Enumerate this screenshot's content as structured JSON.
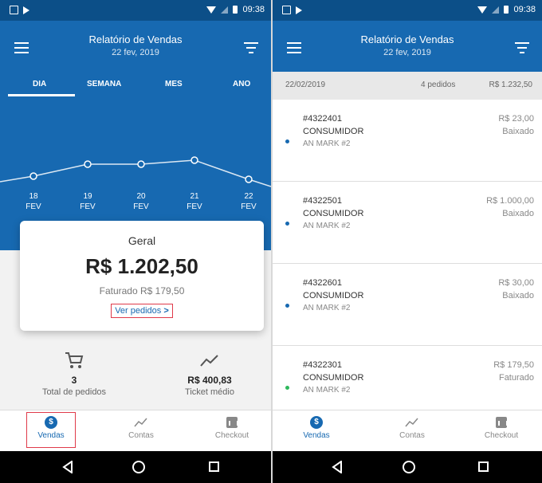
{
  "status": {
    "time": "09:38"
  },
  "colors": {
    "primary": "#1769b1",
    "dark": "#0c4f88",
    "highlight": "#e03a4a",
    "dot_blue": "#1769b1",
    "dot_green": "#2eb85c"
  },
  "left": {
    "header": {
      "title": "Relatório de Vendas",
      "subtitle": "22 fev, 2019"
    },
    "tabs": [
      {
        "label": "DIA"
      },
      {
        "label": "SEMANA"
      },
      {
        "label": "MES"
      },
      {
        "label": "ANO"
      }
    ],
    "days": [
      {
        "day": "18",
        "month": "FEV"
      },
      {
        "day": "19",
        "month": "FEV"
      },
      {
        "day": "20",
        "month": "FEV"
      },
      {
        "day": "21",
        "month": "FEV"
      },
      {
        "day": "22",
        "month": "FEV"
      }
    ],
    "summary": {
      "title": "Geral",
      "amount": "R$ 1.202,50",
      "invoiced": "Faturado R$ 179,50",
      "link_label": "Ver pedidos",
      "link_arrow": ">"
    },
    "stats": [
      {
        "value": "3",
        "label": "Total de pedidos",
        "icon": "cart-icon"
      },
      {
        "value": "R$ 400,83",
        "label": "Ticket médio",
        "icon": "trend-icon"
      }
    ]
  },
  "right": {
    "header": {
      "title": "Relatório de Vendas",
      "subtitle": "22 fev, 2019"
    },
    "datebar": {
      "date": "22/02/2019",
      "count": "4 pedidos",
      "total": "R$ 1.232,50"
    },
    "orders": [
      {
        "number": "#4322401",
        "customer": "CONSUMIDOR",
        "address": "AN MARK #2",
        "amount": "R$ 23,00",
        "status": "Baixado",
        "dot": "blue"
      },
      {
        "number": "#4322501",
        "customer": "CONSUMIDOR",
        "address": "AN MARK #2",
        "amount": "R$ 1.000,00",
        "status": "Baixado",
        "dot": "blue"
      },
      {
        "number": "#4322601",
        "customer": "CONSUMIDOR",
        "address": "AN MARK #2",
        "amount": "R$ 30,00",
        "status": "Baixado",
        "dot": "blue"
      },
      {
        "number": "#4322301",
        "customer": "CONSUMIDOR",
        "address": "AN MARK #2",
        "amount": "R$ 179,50",
        "status": "Faturado",
        "dot": "green"
      }
    ]
  },
  "nav": [
    {
      "label": "Vendas",
      "icon": "dollar-icon"
    },
    {
      "label": "Contas",
      "icon": "trend-icon"
    },
    {
      "label": "Checkout",
      "icon": "checkout-icon"
    }
  ],
  "icons": {
    "dollar_glyph": "$"
  }
}
